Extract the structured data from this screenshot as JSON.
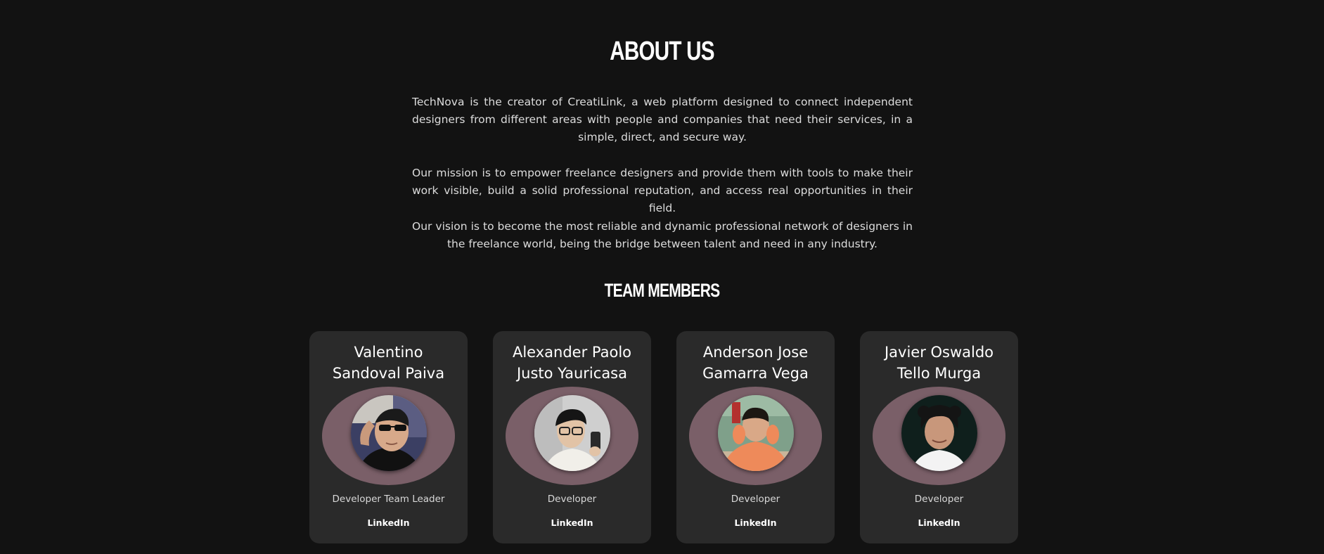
{
  "about": {
    "title": "ABOUT US",
    "paragraphs": [
      "TechNova is the creator of CreatiLink, a web platform designed to connect independent designers from different areas with people and companies that need their services, in a simple, direct, and secure way.",
      "Our mission is to empower freelance designers and provide them with tools to make their work visible, build a solid professional reputation, and access real opportunities in their field.",
      "Our vision is to become the most reliable and dynamic professional network of designers in the freelance world, being the bridge between talent and need in any industry."
    ]
  },
  "team": {
    "title": "TEAM MEMBERS",
    "members": [
      {
        "name": "Valentino Sandoval Paiva",
        "role": "Developer Team Leader",
        "link": "LinkedIn",
        "photo": "member-photo"
      },
      {
        "name": "Alexander Paolo Justo Yauricasa",
        "role": "Developer",
        "link": "LinkedIn",
        "photo": "member-photo"
      },
      {
        "name": "Anderson Jose Gamarra Vega",
        "role": "Developer",
        "link": "LinkedIn",
        "photo": "member-photo"
      },
      {
        "name": "Javier Oswaldo Tello Murga",
        "role": "Developer",
        "link": "LinkedIn",
        "photo": "member-photo"
      }
    ]
  },
  "colors": {
    "background": "#121212",
    "card": "#2a2a2a",
    "halo": "#7a5f68"
  }
}
